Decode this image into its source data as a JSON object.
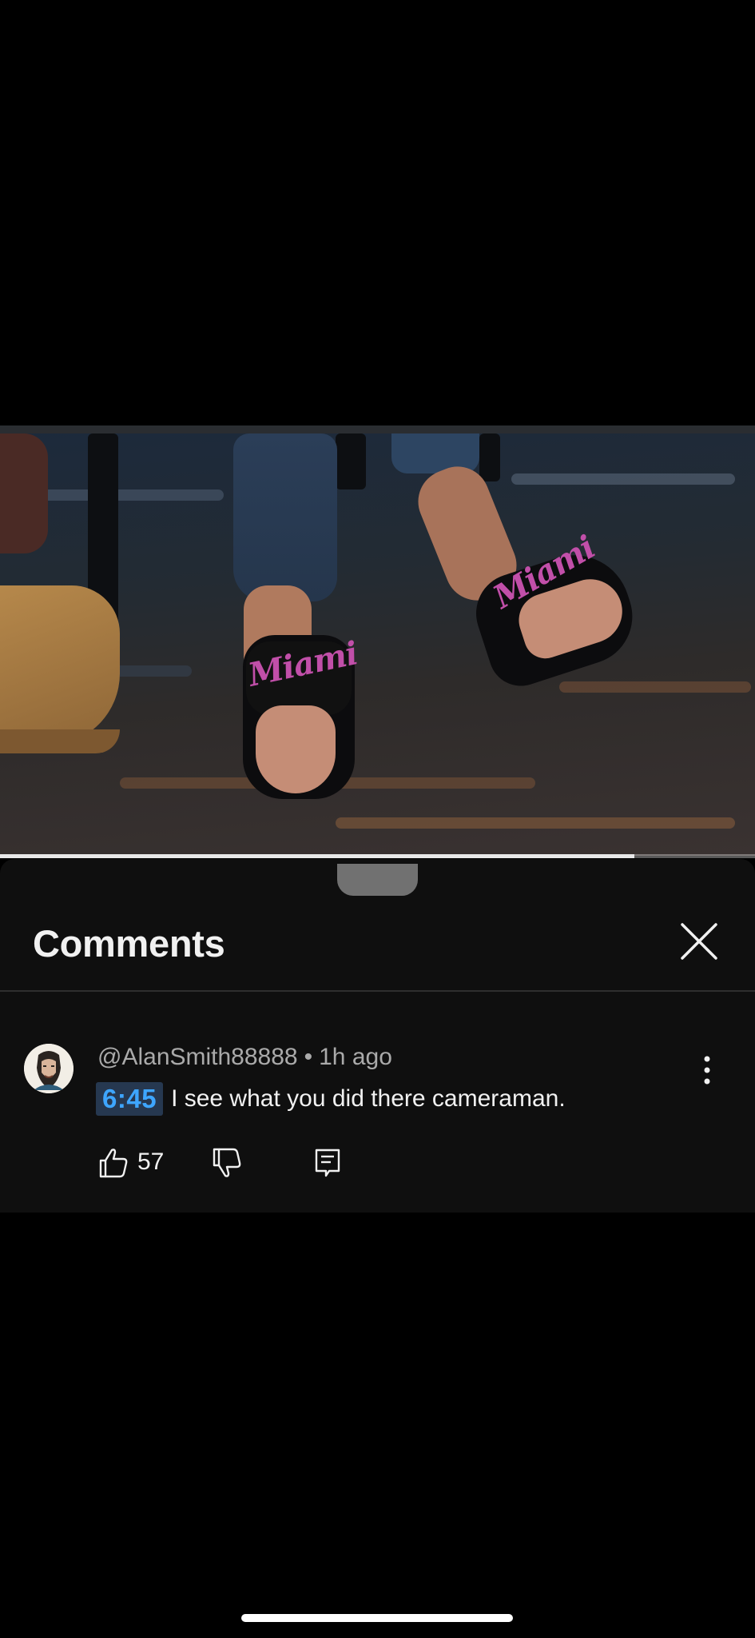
{
  "video": {
    "progress": 0.84,
    "slide_brand": "Miami"
  },
  "comments_panel": {
    "title": "Comments",
    "close_icon": "close-icon"
  },
  "comment": {
    "author": "@AlanSmith88888",
    "separator": "•",
    "age": "1h ago",
    "timestamp": "6:45",
    "text": "I see what you did there cameraman.",
    "likes": "57",
    "icons": {
      "like": "thumbs-up-icon",
      "dislike": "thumbs-down-icon",
      "reply": "reply-icon",
      "more": "more-vert-icon"
    }
  },
  "colors": {
    "panel_bg": "#0f0f0f",
    "timestamp_link": "#3ea6ff",
    "timestamp_bg": "#263850"
  }
}
